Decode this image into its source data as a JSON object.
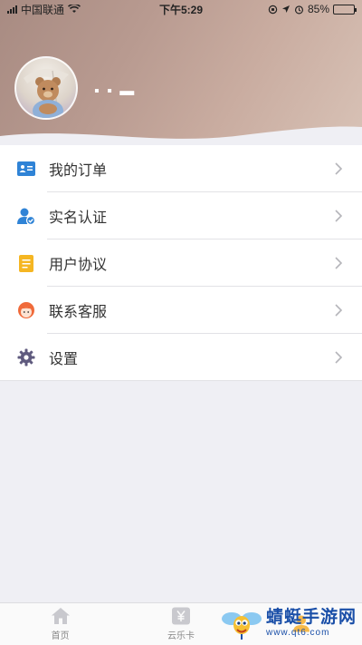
{
  "status_bar": {
    "carrier": "中国联通",
    "time": "下午5:29",
    "battery": "85%",
    "battery_level": 0.85
  },
  "profile": {
    "username": "▪ ▪ ▬"
  },
  "menu": {
    "items": [
      {
        "label": "我的订单",
        "icon": "order-card-icon",
        "color": "#2f83d6"
      },
      {
        "label": "实名认证",
        "icon": "user-verified-icon",
        "color": "#2f83d6"
      },
      {
        "label": "用户协议",
        "icon": "document-icon",
        "color": "#f5b622"
      },
      {
        "label": "联系客服",
        "icon": "customer-service-icon",
        "color": "#f06a3a"
      },
      {
        "label": "设置",
        "icon": "gear-icon",
        "color": "#5f5a7e"
      }
    ]
  },
  "tabbar": {
    "tabs": [
      {
        "label": "首页",
        "icon": "home-icon"
      },
      {
        "label": "云乐卡",
        "icon": "yen-card-icon"
      },
      {
        "label": "",
        "icon": "profile-icon"
      }
    ]
  },
  "watermark": {
    "title": "蜻蜓手游网",
    "subtitle": "www.qt6.com"
  }
}
